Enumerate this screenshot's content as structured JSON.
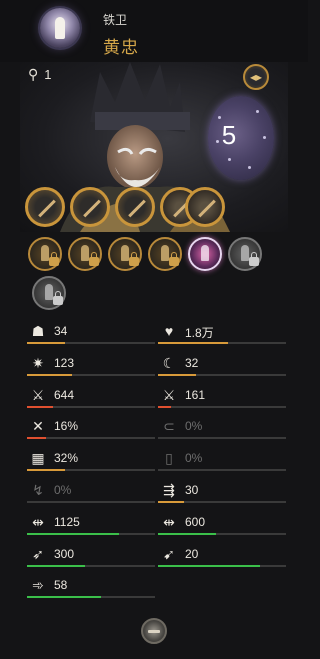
{
  "header": {
    "class_name": "铁卫",
    "hero_name": "黄忠",
    "class_icon": "bullet-icon"
  },
  "portrait": {
    "level_glyph": "⚲",
    "level": "1",
    "stars": "5",
    "swap_glyph": "◂▸"
  },
  "equipment": [
    {
      "slot": "weapon-1",
      "icon": "sword-icon",
      "filled": false
    },
    {
      "slot": "weapon-2",
      "icon": "sword-icon",
      "filled": false
    },
    {
      "slot": "armor",
      "icon": "sword-icon",
      "filled": false
    },
    {
      "slot": "helmet",
      "icon": "helmet-icon",
      "filled": true
    },
    {
      "slot": "mount",
      "icon": "horse-icon",
      "filled": true
    }
  ],
  "skills": [
    {
      "icon": "soldier-skill-icon",
      "state": "locked"
    },
    {
      "icon": "soldier-skill-icon",
      "state": "locked"
    },
    {
      "icon": "soldier-skill-icon",
      "state": "locked"
    },
    {
      "icon": "soldier-skill-icon",
      "state": "locked"
    },
    {
      "icon": "special-skill-icon",
      "state": "active"
    },
    {
      "icon": "soldier-skill-icon",
      "state": "grey-locked"
    },
    {
      "icon": "soldier-skill-icon",
      "state": "grey-locked"
    }
  ],
  "stats": [
    {
      "icon": "command-icon",
      "glyph": "☗",
      "value": "34",
      "bar": 0.3,
      "color": "#d89a3a",
      "dim": false
    },
    {
      "icon": "heart-icon",
      "glyph": "♥",
      "value": "1.8万",
      "bar": 0.55,
      "color": "#d89a3a",
      "dim": false
    },
    {
      "icon": "spark-icon",
      "glyph": "✷",
      "value": "123",
      "bar": 0.35,
      "color": "#d89a3a",
      "dim": false
    },
    {
      "icon": "sickle-icon",
      "glyph": "☾",
      "value": "32",
      "bar": 0.3,
      "color": "#d89a3a",
      "dim": false
    },
    {
      "icon": "attack-icon",
      "glyph": "⚔",
      "value": "644",
      "bar": 0.2,
      "color": "#e05030",
      "dim": false
    },
    {
      "icon": "attack-icon",
      "glyph": "⚔",
      "value": "161",
      "bar": 0.1,
      "color": "#e05030",
      "dim": false
    },
    {
      "icon": "pierce-icon",
      "glyph": "✕",
      "value": "16%",
      "bar": 0.15,
      "color": "#e05030",
      "dim": false
    },
    {
      "icon": "block-icon",
      "glyph": "⊂",
      "value": "0%",
      "bar": 0,
      "color": "#e05030",
      "dim": true
    },
    {
      "icon": "armor-icon",
      "glyph": "▦",
      "value": "32%",
      "bar": 0.3,
      "color": "#d89a3a",
      "dim": false
    },
    {
      "icon": "shield-icon",
      "glyph": "▯",
      "value": "0%",
      "bar": 0,
      "color": "#d89a3a",
      "dim": true
    },
    {
      "icon": "kick-icon",
      "glyph": "↯",
      "value": "0%",
      "bar": 0,
      "color": "#d89a3a",
      "dim": true
    },
    {
      "icon": "arrows-icon",
      "glyph": "⇶",
      "value": "30",
      "bar": 0.2,
      "color": "#d89a3a",
      "dim": false
    },
    {
      "icon": "speed-icon",
      "glyph": "⇹",
      "value": "1125",
      "bar": 0.72,
      "color": "#3bc04a",
      "dim": false
    },
    {
      "icon": "speed-icon",
      "glyph": "⇹",
      "value": "600",
      "bar": 0.45,
      "color": "#3bc04a",
      "dim": false
    },
    {
      "icon": "bow-icon",
      "glyph": "➶",
      "value": "300",
      "bar": 0.45,
      "color": "#3bc04a",
      "dim": false
    },
    {
      "icon": "volley-icon",
      "glyph": "➹",
      "value": "20",
      "bar": 0.8,
      "color": "#3bc04a",
      "dim": false
    },
    {
      "icon": "charge-icon",
      "glyph": "➾",
      "value": "58",
      "bar": 0.58,
      "color": "#3bc04a",
      "dim": false
    }
  ],
  "footer": {
    "icon": "collapse-icon"
  }
}
